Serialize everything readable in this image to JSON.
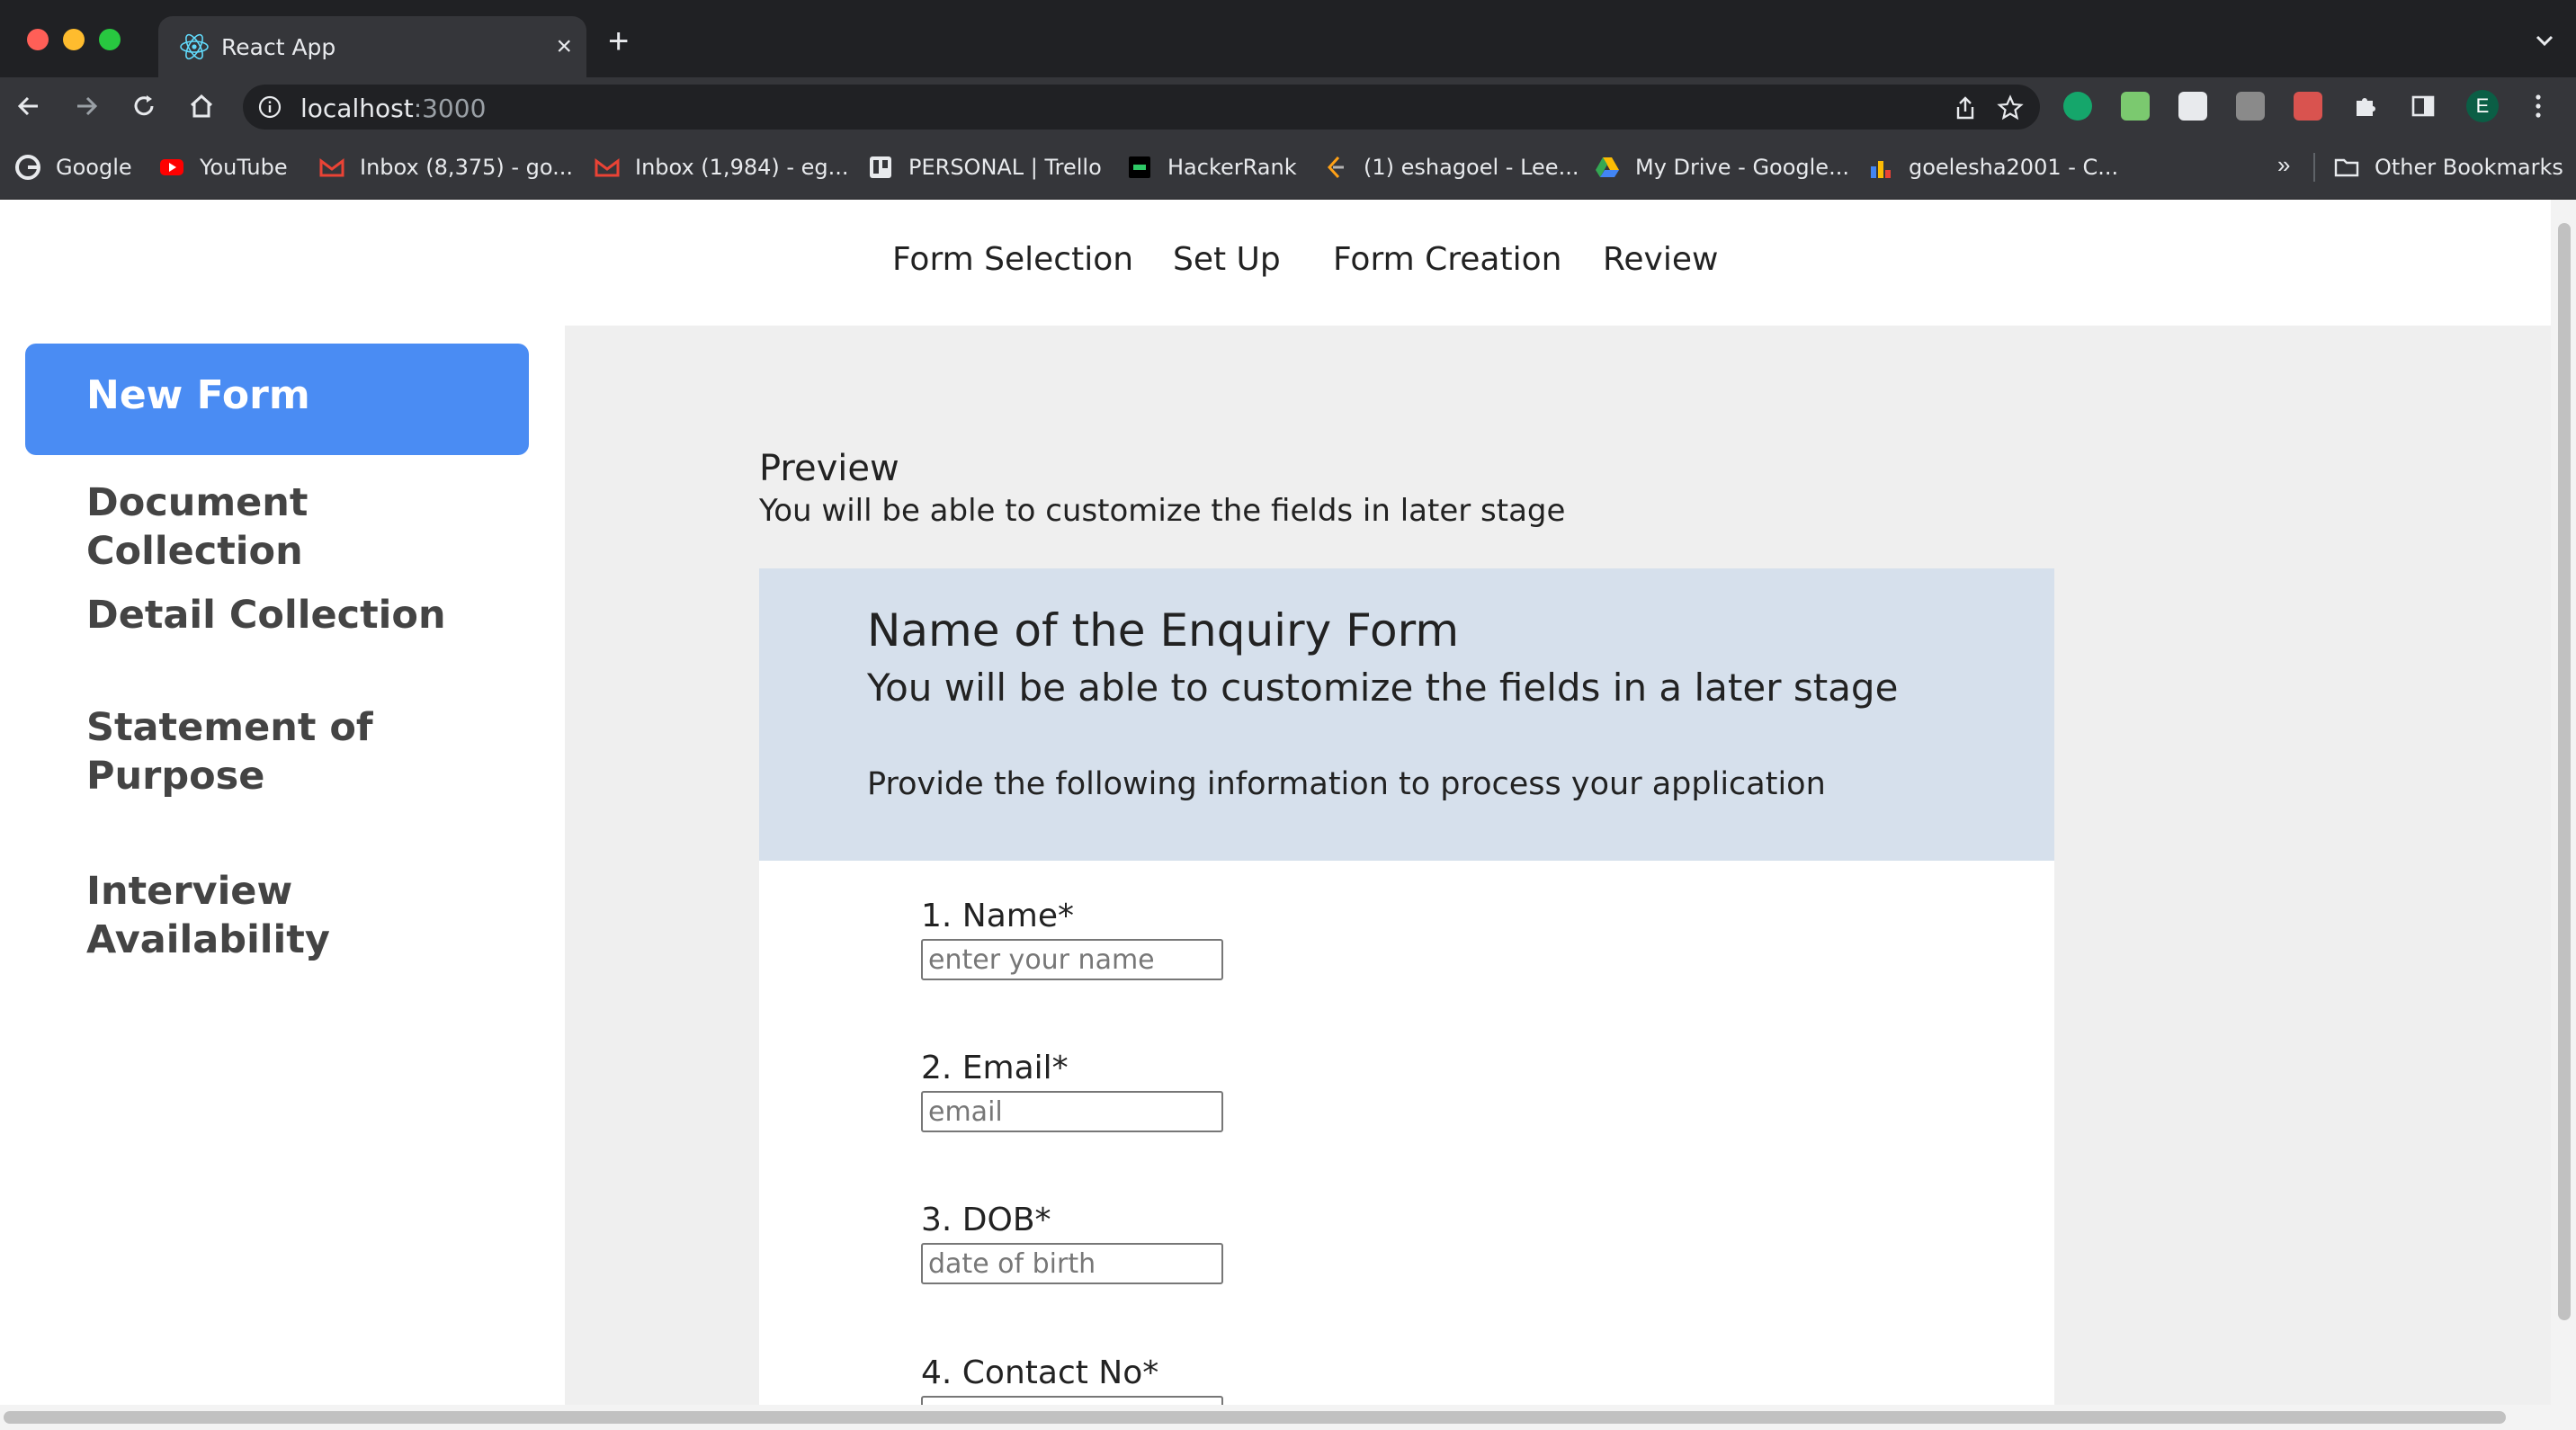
{
  "browser": {
    "tab_title": "React App",
    "tab_close": "×",
    "new_tab": "+",
    "url_host": "localhost",
    "url_port": ":3000",
    "profile_initial": "E",
    "bookmarks": [
      {
        "label": "Google",
        "icon": "google-icon"
      },
      {
        "label": "YouTube",
        "icon": "youtube-icon"
      },
      {
        "label": "Inbox (8,375) - go...",
        "icon": "gmail-icon"
      },
      {
        "label": "Inbox (1,984) - eg...",
        "icon": "gmail-icon"
      },
      {
        "label": "PERSONAL | Trello",
        "icon": "trello-icon"
      },
      {
        "label": "HackerRank",
        "icon": "hackerrank-icon"
      },
      {
        "label": "(1) eshagoel - Lee...",
        "icon": "leetcode-icon"
      },
      {
        "label": "My Drive - Google...",
        "icon": "drive-icon"
      },
      {
        "label": "goelesha2001 - C...",
        "icon": "chart-icon"
      }
    ],
    "bookmarks_more": "»",
    "other_bookmarks": "Other Bookmarks"
  },
  "topnav": {
    "items": [
      "Form Selection",
      "Set Up",
      "Form Creation",
      "Review"
    ]
  },
  "sidebar": {
    "active": "New Form",
    "items": [
      "Document Collection",
      "Detail Collection",
      "Statement of Purpose",
      "Interview Availability"
    ]
  },
  "preview": {
    "title": "Preview",
    "subtitle": "You will be able to customize the fields in later stage"
  },
  "form": {
    "title": "Name of the Enquiry Form",
    "subtitle": "You will be able to customize the fields in a later stage",
    "info": "Provide the following information to process your application",
    "fields": [
      {
        "label": "1. Name*",
        "placeholder": "enter your name"
      },
      {
        "label": "2. Email*",
        "placeholder": "email"
      },
      {
        "label": "3. DOB*",
        "placeholder": "date of birth"
      },
      {
        "label": "4. Contact No*",
        "placeholder": ""
      }
    ]
  },
  "colors": {
    "accent": "#4a8cf3",
    "form_header": "#d6e0ec",
    "main_bg": "#efefef",
    "chrome_dark": "#202124"
  }
}
